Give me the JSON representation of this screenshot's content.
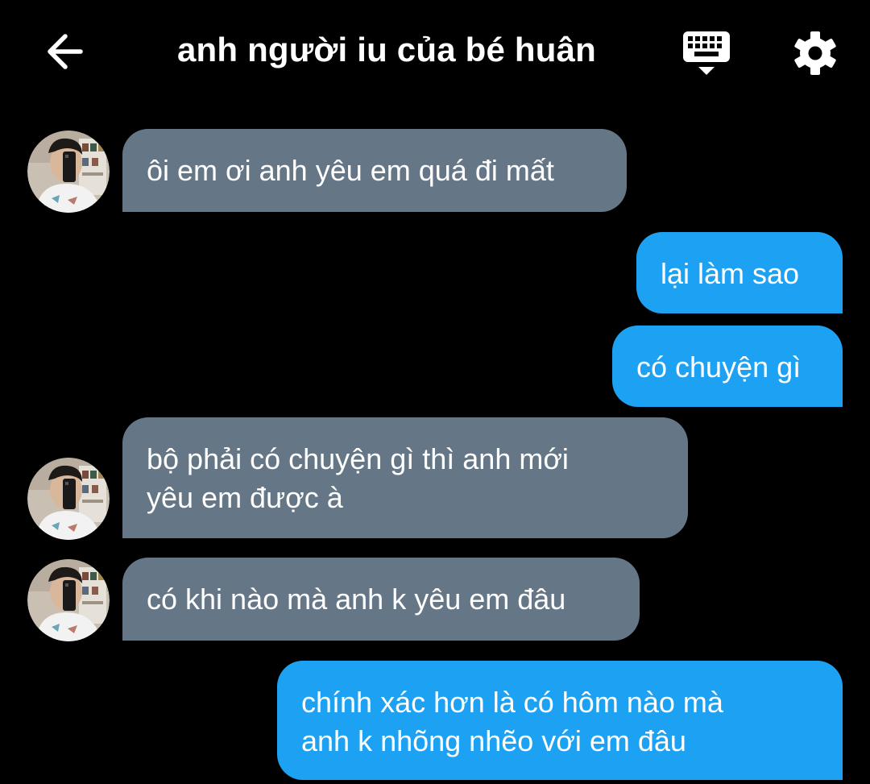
{
  "header": {
    "title": "anh người iu của bé huân",
    "back_icon": "arrow-left-icon",
    "keyboard_icon": "keyboard-icon",
    "settings_icon": "gear-icon"
  },
  "colors": {
    "background": "#000000",
    "received_bubble": "#657786",
    "sent_bubble": "#1da1f2",
    "text": "#ffffff"
  },
  "messages": [
    {
      "from": "them",
      "text": "ôi em ơi anh yêu em quá đi mất"
    },
    {
      "from": "me",
      "text": "lại làm sao"
    },
    {
      "from": "me",
      "text": "có chuyện gì"
    },
    {
      "from": "them",
      "text": "bộ phải có chuyện gì thì anh mới\nyêu em được à"
    },
    {
      "from": "them",
      "text": "có khi nào mà anh k yêu em đâu"
    },
    {
      "from": "me",
      "text": "chính xác hơn là có hôm nào mà\nanh k nhõng nhẽo với em đâu"
    }
  ]
}
